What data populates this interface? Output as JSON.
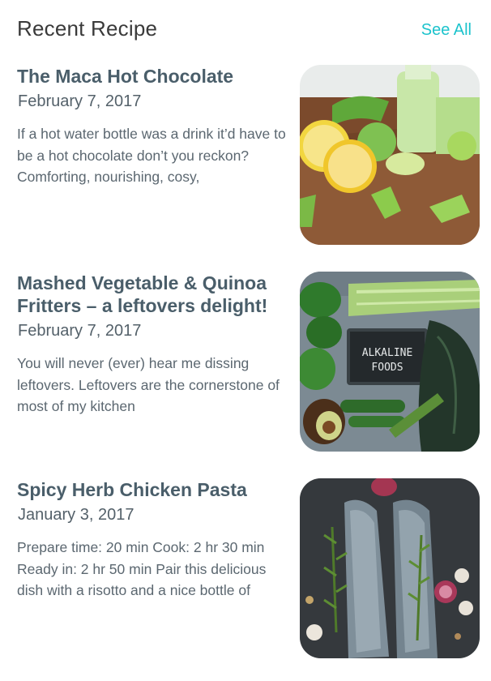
{
  "header": {
    "title": "Recent Recipe",
    "see_all_label": "See All"
  },
  "recipes": [
    {
      "title": "The Maca Hot Chocolate",
      "date": "February 7, 2017",
      "excerpt": "If a hot water bottle was a drink it’d have to be a hot chocolate don’t you reckon? Comforting, nourishing, cosy,"
    },
    {
      "title": "Mashed Vegetable & Quinoa Fritters – a leftovers delight!",
      "date": "February 7, 2017",
      "excerpt": "You will never (ever) hear me dissing leftovers. Leftovers are the cornerstone of most of my kitchen",
      "image_sign_text_1": "ALKALINE",
      "image_sign_text_2": "FOODS"
    },
    {
      "title": "Spicy Herb Chicken Pasta",
      "date": "January 3, 2017",
      "excerpt": "Prepare time: 20 min Cook: 2 hr 30 min Ready in: 2 hr 50 min Pair this delicious dish with a risotto and a nice bottle of"
    }
  ]
}
